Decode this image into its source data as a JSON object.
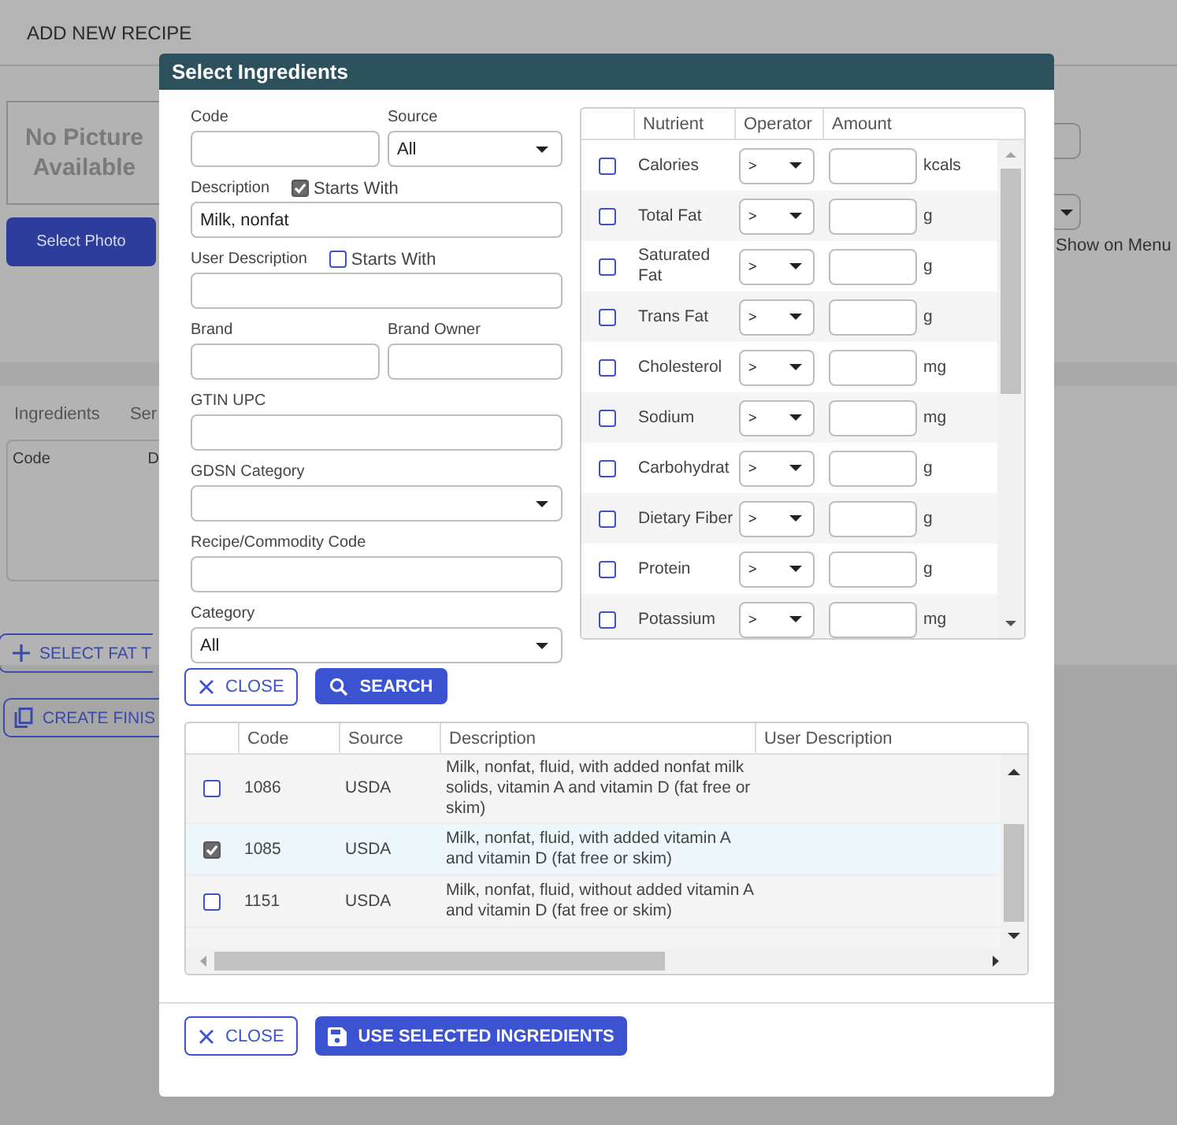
{
  "page": {
    "title": "ADD NEW RECIPE",
    "photo_placeholder": "No Picture Available",
    "photo_button": "Select Photo",
    "show_on_menu": "Show on Menu",
    "tabs": [
      {
        "label": "Ingredients"
      },
      {
        "label": "Ser"
      }
    ],
    "ingredient_columns": [
      "Code",
      "D"
    ],
    "select_fat_button": "SELECT FAT T",
    "create_button": "CREATE FINIS"
  },
  "dialog": {
    "title": "Select Ingredients",
    "form": {
      "rows": [
        {
          "fields": [
            {
              "kind": "input",
              "label": "Code"
            },
            {
              "kind": "select",
              "label": "Source",
              "value": "All"
            }
          ]
        },
        {
          "fields": [
            {
              "kind": "input",
              "label": "Description",
              "value": "Milk, nonfat",
              "starts_with": {
                "label": "Starts With",
                "checked": true
              }
            }
          ]
        },
        {
          "fields": [
            {
              "kind": "input",
              "label": "User Description",
              "starts_with": {
                "label": "Starts With",
                "checked": false
              }
            }
          ]
        },
        {
          "fields": [
            {
              "kind": "input",
              "label": "Brand"
            },
            {
              "kind": "input",
              "label": "Brand Owner"
            }
          ]
        },
        {
          "fields": [
            {
              "kind": "input",
              "label": "GTIN UPC"
            }
          ]
        },
        {
          "fields": [
            {
              "kind": "select",
              "label": "GDSN Category"
            }
          ]
        },
        {
          "fields": [
            {
              "kind": "input",
              "label": "Recipe/Commodity Code"
            }
          ]
        },
        {
          "fields": [
            {
              "kind": "select",
              "label": "Category",
              "value": "All"
            }
          ]
        }
      ]
    },
    "nutrients": {
      "columns": [
        "Nutrient",
        "Operator",
        "Amount"
      ],
      "rows": [
        {
          "name": "Calories",
          "checked": false,
          "operator": ">",
          "unit": "kcals"
        },
        {
          "name": "Total Fat",
          "checked": false,
          "operator": ">",
          "unit": "g"
        },
        {
          "name": "Saturated Fat",
          "checked": false,
          "operator": ">",
          "unit": "g"
        },
        {
          "name": "Trans Fat",
          "checked": false,
          "operator": ">",
          "unit": "g"
        },
        {
          "name": "Cholesterol",
          "checked": false,
          "operator": ">",
          "unit": "mg"
        },
        {
          "name": "Sodium",
          "checked": false,
          "operator": ">",
          "unit": "mg"
        },
        {
          "name": "Carbohydrat",
          "checked": false,
          "operator": ">",
          "unit": "g"
        },
        {
          "name": "Dietary Fiber",
          "checked": false,
          "operator": ">",
          "unit": "g"
        },
        {
          "name": "Protein",
          "checked": false,
          "operator": ">",
          "unit": "g"
        },
        {
          "name": "Potassium",
          "checked": false,
          "operator": ">",
          "unit": "mg"
        }
      ]
    },
    "close_button": "CLOSE",
    "search_button": "SEARCH",
    "results": {
      "columns": [
        "Code",
        "Source",
        "Description",
        "User Description"
      ],
      "rows": [
        {
          "checked": false,
          "code": "1086",
          "source": "USDA",
          "description": "Milk, nonfat, fluid, with added nonfat milk solids, vitamin A and vitamin D (fat free or skim)"
        },
        {
          "checked": true,
          "code": "1085",
          "source": "USDA",
          "description": "Milk, nonfat, fluid, with added vitamin A and vitamin D (fat free or skim)"
        },
        {
          "checked": false,
          "code": "1151",
          "source": "USDA",
          "description": "Milk, nonfat, fluid, without added vitamin A and vitamin D (fat free or skim)"
        }
      ]
    },
    "footer": {
      "close_button": "CLOSE",
      "use_button": "USE SELECTED INGREDIENTS"
    }
  }
}
